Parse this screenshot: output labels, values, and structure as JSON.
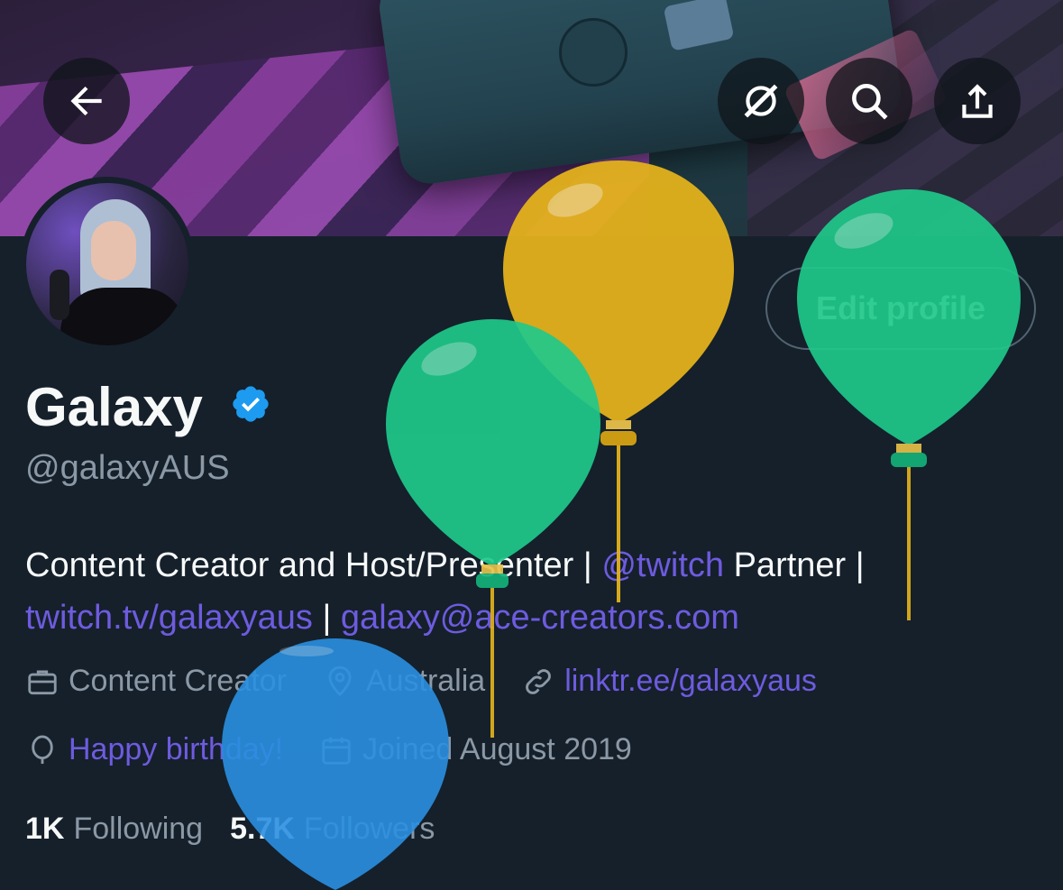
{
  "header": {
    "back_icon": "arrow-left-icon",
    "grok_icon": "grok-icon",
    "search_icon": "search-icon",
    "share_icon": "share-icon"
  },
  "profile": {
    "edit_label": "Edit profile",
    "name": "Galaxy",
    "verified": true,
    "handle": "@galaxyAUS",
    "bio": {
      "part1": "Content Creator and Host/Presenter | ",
      "mention": "@twitch",
      "part2": " Partner | ",
      "link1": "twitch.tv/galaxyaus",
      "sep": " | ",
      "email": "galaxy@ace-creators.com"
    },
    "profession": "Content Creator",
    "location": "Australia",
    "website": "linktr.ee/galaxyaus",
    "birthday": "Happy birthday!",
    "joined": "Joined August 2019",
    "following_count": "1K",
    "following_label": "Following",
    "followers_count": "5.7K",
    "followers_label": "Followers"
  },
  "colors": {
    "background": "#15202b",
    "link": "#6e5bdf",
    "muted": "#8b98a5",
    "verified": "#1d9bf0",
    "balloon_yellow": "#e3b21c",
    "balloon_green": "#1fc98a",
    "balloon_blue": "#2a8fe0"
  }
}
